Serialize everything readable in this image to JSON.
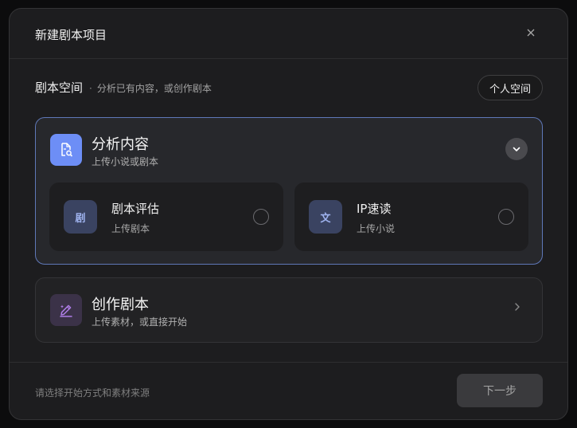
{
  "dialog": {
    "title": "新建剧本项目",
    "close_icon": "close-icon"
  },
  "section": {
    "title": "剧本空间",
    "separator": "·",
    "description": "分析已有内容，或创作剧本",
    "space_button_label": "个人空间"
  },
  "analysis_card": {
    "icon": "document-search-icon",
    "title": "分析内容",
    "subtitle": "上传小说或剧本",
    "toggle_icon": "chevron-down-icon",
    "options": [
      {
        "icon_text": "剧",
        "title": "剧本评估",
        "subtitle": "上传剧本",
        "selected": false
      },
      {
        "icon_text": "文",
        "title": "IP速读",
        "subtitle": "上传小说",
        "selected": false
      }
    ]
  },
  "create_card": {
    "icon": "pencil-sparkle-icon",
    "title": "创作剧本",
    "subtitle": "上传素材，或直接开始",
    "arrow_icon": "chevron-right-icon"
  },
  "footer": {
    "hint": "请选择开始方式和素材来源",
    "next_label": "下一步"
  },
  "colors": {
    "accent": "#6d8ef6",
    "selected_border": "#5f78b8",
    "create_icon_bg": "#3b3248"
  }
}
